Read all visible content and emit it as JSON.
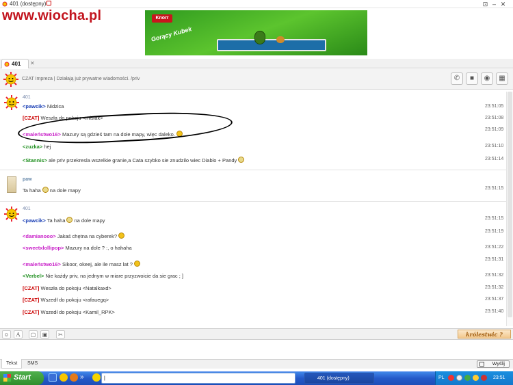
{
  "window": {
    "title": "401 (dostępny)"
  },
  "watermark": "www.wiocha.pl",
  "banner": {
    "brand": "Knorr",
    "product": "Gorący Kubek"
  },
  "tabs": [
    {
      "label": "401"
    }
  ],
  "channel": {
    "topic": "CZAT Impreza | Działają już prywatne wiadomości. /priv"
  },
  "header_buttons": [
    "phone-icon",
    "camera-icon",
    "gamepad-icon",
    "gift-icon"
  ],
  "messages": {
    "block1": {
      "sender": "401",
      "lines": [
        {
          "nick": "<pawcik>",
          "text": " Nidzica",
          "time": "23:51:05"
        },
        {
          "nick": "[CZAT]",
          "text": " Weszła do pokoju <misiak>",
          "time": "23:51:08"
        },
        {
          "nick": "<maleństwo16>",
          "text": " Mazury są gdzieś tam na dole mapy, więc daleko.",
          "time": "23:51:09"
        },
        {
          "nick": "<zuzka>",
          "text": " hej",
          "time": "23:51:10"
        },
        {
          "nick": "<Stannis>",
          "text": " ale priv przekresla wszelkie granie,a Cata szybko sie znudzilo wiec Diablo + Pandy",
          "time": "23:51:14"
        }
      ]
    },
    "block2": {
      "sender": "paw",
      "lines": [
        {
          "nick": "",
          "text": "Ta haha",
          "text2": " na dole mapy",
          "time": "23:51:15"
        }
      ]
    },
    "block3": {
      "sender": "401",
      "lines": [
        {
          "nick": "<pawcik>",
          "text": " Ta haha",
          "text2": " na dole mapy",
          "time": "23:51:15"
        },
        {
          "nick": "<damianooo>",
          "text": " Jakaś chętna na cyberek?",
          "time": "23:51:19"
        },
        {
          "nick": "<sweetxlollipop>",
          "text": " Mazury na dole ? :, o hahaha",
          "time": "23:51:22"
        },
        {
          "nick": "<maleństwo16>",
          "text": " Sikoor, okeej, ale ile masz lat ?",
          "time": "23:51:31"
        },
        {
          "nick": "<Verbel>",
          "text": " Nie każdy priv, na jednym w miare przyzwoicie da sie grac ; ]",
          "time": "23:51:32"
        },
        {
          "nick": "[CZAT]",
          "text": " Weszła do pokoju <Natalkaxd>",
          "time": "23:51:32"
        },
        {
          "nick": "[CZAT]",
          "text": " Wszedł do pokoju <rafauegq>",
          "time": "23:51:37"
        },
        {
          "nick": "[CZAT]",
          "text": " Wszedł do pokoju <Kamil_RPK>",
          "time": "23:51:40"
        }
      ]
    }
  },
  "compose": {
    "badge": "królestwic ?"
  },
  "mode_tabs": {
    "text": "Tekst",
    "sms": "SMS"
  },
  "send_button": "Wyślij",
  "taskbar": {
    "start": "Start",
    "active_window": "401 (dostępny)",
    "input_placeholder": "|"
  },
  "tray": {
    "language": "PL",
    "clock": "23:51"
  },
  "colors": {
    "system": "#cc0000",
    "nick_blue": "#1a3fb5",
    "nick_magenta": "#c81ec8",
    "nick_green": "#1f8f1f",
    "timestamp": "#666666"
  }
}
